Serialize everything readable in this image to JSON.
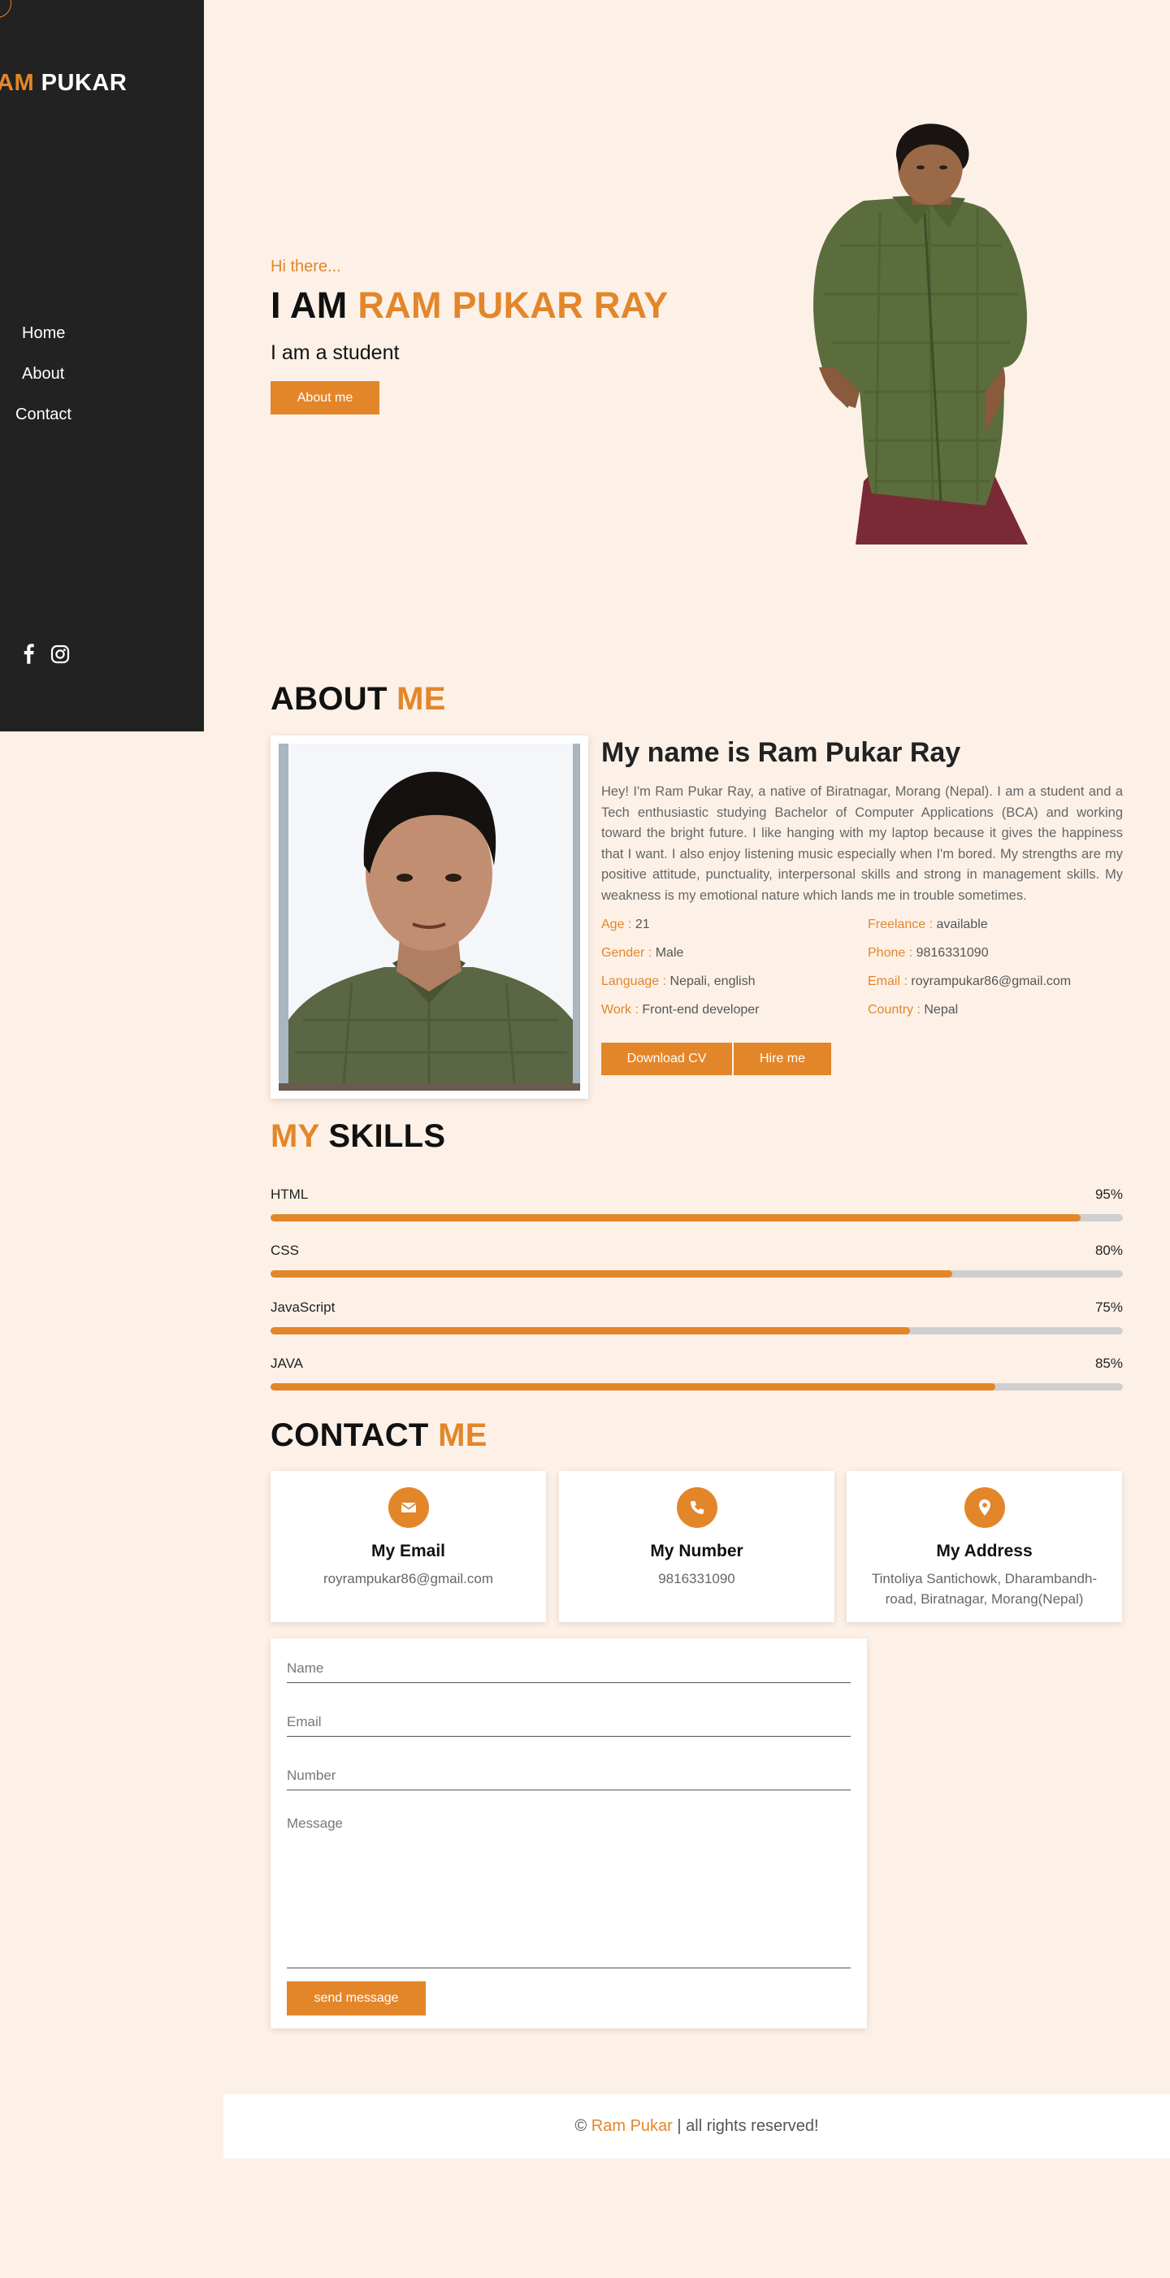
{
  "sidebar": {
    "logo_first": "AM",
    "logo_second": "PUKAR",
    "nav": [
      "Home",
      "About",
      "Contact"
    ],
    "social_icons": [
      "facebook-icon",
      "instagram-icon"
    ]
  },
  "hero": {
    "greeting": "Hi there...",
    "title_prefix": "I AM",
    "title_name": "RAM PUKAR RAY",
    "subtitle": "I am a student",
    "button": "About me"
  },
  "about": {
    "heading_1": "ABOUT",
    "heading_2": "ME",
    "name_heading": "My name is Ram Pukar Ray",
    "bio": "Hey! I'm Ram Pukar Ray, a native of Biratnagar, Morang (Nepal). I am a student and a Tech enthusiastic studying Bachelor of Computer Applications (BCA) and working toward the bright future. I like hanging with my laptop because it gives the happiness that I want. I also enjoy listening music especially when I'm bored. My strengths are my positive attitude, punctuality, interpersonal skills and strong in management skills. My weakness is my emotional nature which lands me in trouble sometimes.",
    "info": [
      {
        "label": "Age :",
        "value": "21"
      },
      {
        "label": "Freelance :",
        "value": "available"
      },
      {
        "label": "Gender :",
        "value": "Male"
      },
      {
        "label": "Phone :",
        "value": "9816331090"
      },
      {
        "label": "Language :",
        "value": "Nepali, english"
      },
      {
        "label": "Email :",
        "value": "royrampukar86@gmail.com"
      },
      {
        "label": "Work :",
        "value": "Front-end developer"
      },
      {
        "label": "Country :",
        "value": "Nepal"
      }
    ],
    "download_button": "Download CV",
    "hire_button": "Hire me"
  },
  "skills": {
    "heading_1": "MY",
    "heading_2": "SKILLS",
    "items": [
      {
        "name": "HTML",
        "percent_label": "95%",
        "level": 0.95
      },
      {
        "name": "CSS",
        "percent_label": "80%",
        "level": 0.8
      },
      {
        "name": "JavaScript",
        "percent_label": "75%",
        "level": 0.75
      },
      {
        "name": "JAVA",
        "percent_label": "85%",
        "level": 0.85
      }
    ]
  },
  "contact": {
    "heading_1": "CONTACT",
    "heading_2": "ME",
    "cards": [
      {
        "icon": "envelope-icon",
        "title": "My Email",
        "value": "royrampukar86@gmail.com"
      },
      {
        "icon": "phone-icon",
        "title": "My Number",
        "value": "9816331090"
      },
      {
        "icon": "location-pin-icon",
        "title": "My Address",
        "value": "Tintoliya Santichowk, Dharambandh-road, Biratnagar, Morang(Nepal)"
      }
    ],
    "form": {
      "name_placeholder": "Name",
      "email_placeholder": "Email",
      "number_placeholder": "Number",
      "message_placeholder": "Message",
      "send_button": "send message"
    }
  },
  "footer": {
    "copyright": "©",
    "name": "Ram Pukar",
    "rights": "| all rights reserved!"
  },
  "colors": {
    "accent": "#e3862a",
    "sidebar": "#222222",
    "background": "#fdf1e7"
  }
}
